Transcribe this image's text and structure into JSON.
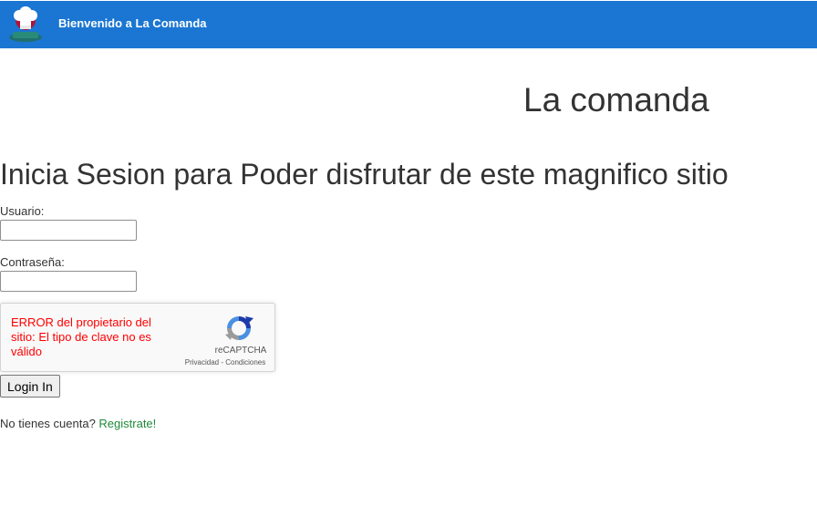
{
  "navbar": {
    "brand": "Bienvenido a La Comanda",
    "background": "#1a76d2"
  },
  "header": {
    "title": "La comanda"
  },
  "login": {
    "heading": "Inicia Sesion para Poder disfrutar de este magnifico sitio",
    "user_label": "Usuario:",
    "user_value": "",
    "password_label": "Contraseña:",
    "password_value": "",
    "submit_label": "Login In"
  },
  "captcha": {
    "error": "ERROR del propietario del sitio: El tipo de clave no es válido",
    "brand": "reCAPTCHA",
    "privacy": "Privacidad",
    "separator": " - ",
    "terms": "Condiciones",
    "error_color": "#ff0000"
  },
  "register": {
    "prompt": "No tienes cuenta? ",
    "link": "Registrate!",
    "link_color": "#1e8a3a"
  }
}
